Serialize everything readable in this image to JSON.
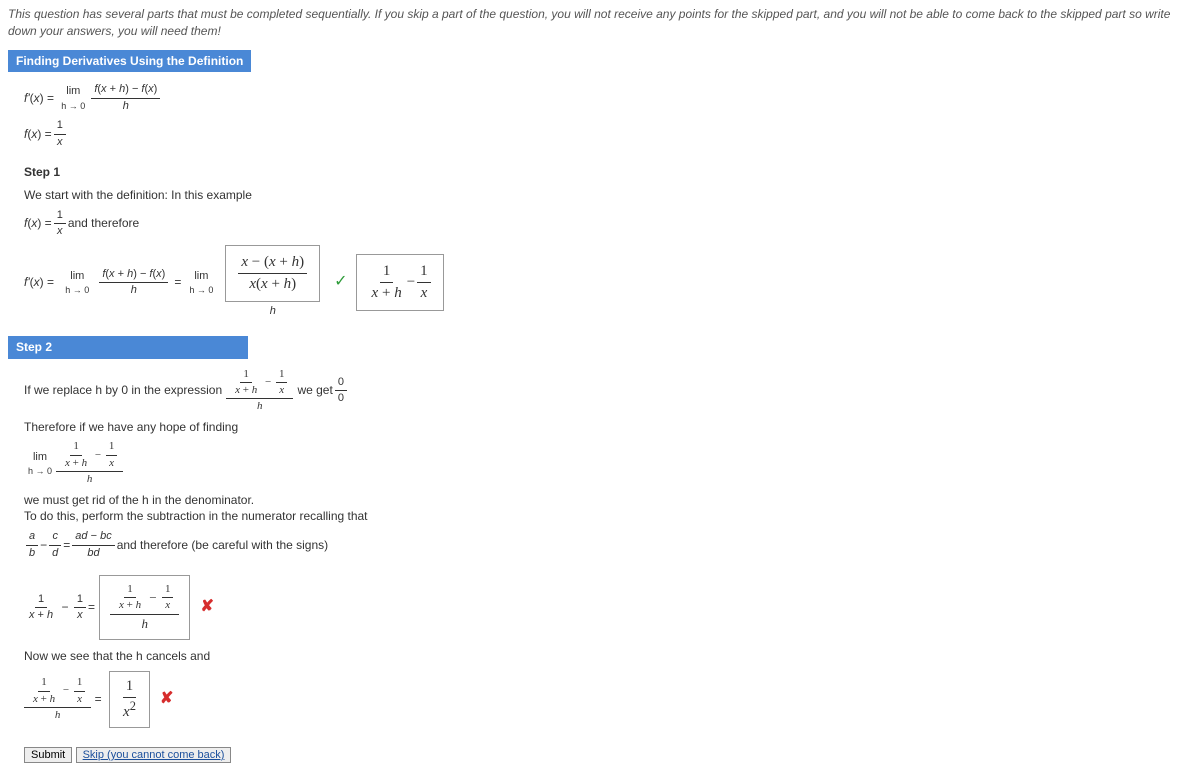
{
  "warning_text": "This question has several parts that must be completed sequentially. If you skip a part of the question, you will not receive any points for the skipped part, and you will not be able to come back to the skipped part so write down your answers, you will need them!",
  "section_title": "Finding Derivatives Using the Definition",
  "given": {
    "fprime_label": "f'(x) = ",
    "lim_label": "lim",
    "lim_sub": "h → 0",
    "def_num": "f(x + h) − f(x)",
    "def_den": "h",
    "fx_label": "f(x) = ",
    "fx_num": "1",
    "fx_den": "x"
  },
  "step1": {
    "label": "Step 1",
    "intro": "We start with the definition: In this example",
    "fx_num": "1",
    "fx_den": "x",
    "therefore": " and therefore",
    "fprime_label": "f'(x) = ",
    "lim_label": "lim",
    "lim_sub": "h → 0",
    "def_num": "f(x + h) − f(x)",
    "def_den": "h",
    "eq": " = ",
    "lim2_label": "lim",
    "lim2_sub": "h → 0",
    "ans1_num": "x − (x + h)",
    "ans1_den": "x(x + h)",
    "under_h": "h",
    "check": "✓",
    "ans2_left_num": "1",
    "ans2_left_den": "x + h",
    "minus": " − ",
    "ans2_right_num": "1",
    "ans2_right_den": "x"
  },
  "step2": {
    "label": "Step 2",
    "line1_a": "If we replace h by 0 in the expression ",
    "expr_top_left_num": "1",
    "expr_top_left_den": "x + h",
    "expr_top_right_num": "1",
    "expr_top_right_den": "x",
    "expr_bot": "h",
    "line1_b": " we get ",
    "res_num": "0",
    "res_den": "0",
    "line2": "Therefore if we have any hope of finding",
    "lim_label": "lim",
    "lim_sub": "h → 0",
    "lim_top_left_num": "1",
    "lim_top_left_den": "x + h",
    "lim_top_right_num": "1",
    "lim_top_right_den": "x",
    "lim_bot": "h",
    "line3": "we must get rid of the h in the denominator.",
    "line4": "To do this, perform the subtraction in the numerator recalling that",
    "rule_a_num": "a",
    "rule_a_den": "b",
    "rule_minus": " − ",
    "rule_c_num": "c",
    "rule_c_den": "d",
    "rule_eq": " = ",
    "rule_r_num": "ad − bc",
    "rule_r_den": "bd",
    "line4b": " and therefore (be careful with the signs)",
    "expr2_left_num": "1",
    "expr2_left_den": "x + h",
    "expr2_right_num": "1",
    "expr2_right_den": "x",
    "eq": " = ",
    "ans3_left_num": "1",
    "ans3_left_den": "x + h",
    "ans3_right_num": "1",
    "ans3_right_den": "x",
    "ans3_bot": "h",
    "cross": "✘",
    "line5": "Now we see that the h cancels and",
    "cancel_left_num": "1",
    "cancel_left_den": "x + h",
    "cancel_right_num": "1",
    "cancel_right_den": "x",
    "cancel_bot": "h",
    "ans4_num": "1",
    "ans4_den": "x²"
  },
  "buttons": {
    "submit": "Submit",
    "skip": "Skip (you cannot come back)"
  }
}
